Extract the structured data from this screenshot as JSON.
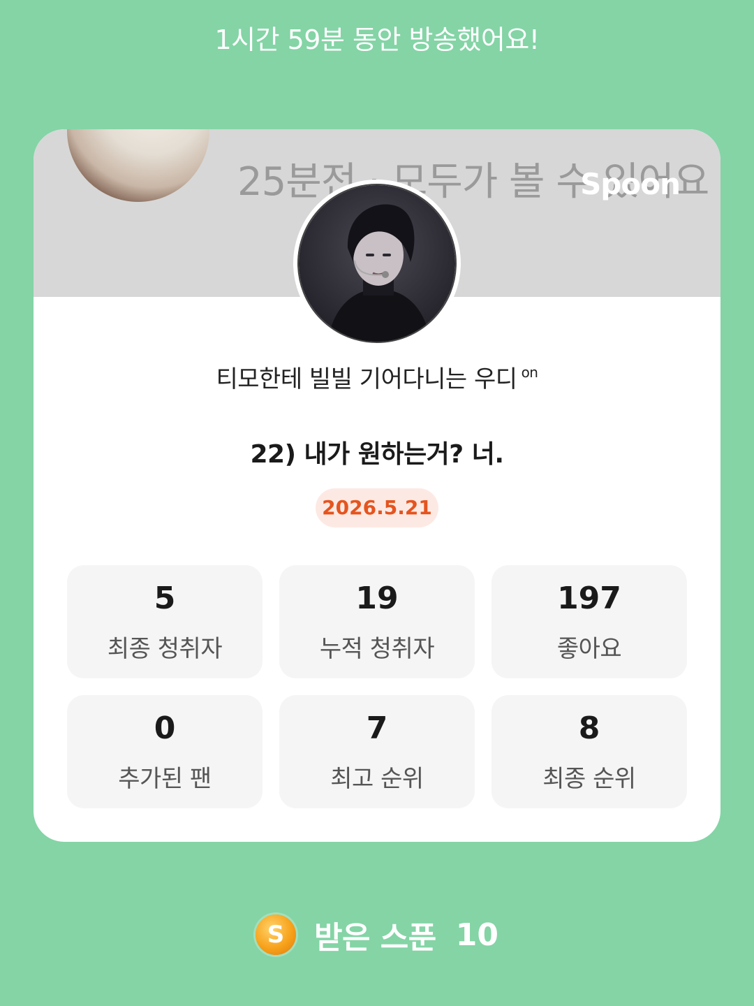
{
  "header": {
    "duration_text": "1시간 59분 동안 방송했어요!"
  },
  "banner": {
    "subtitle": "25분전 · 모두가 볼 수 있어요",
    "brand": "Spoon"
  },
  "dj": {
    "name": "티모한테 빌빌 기어다니는 우디",
    "badge": "on"
  },
  "broadcast": {
    "title": "22) 내가 원하는거? 너.",
    "date": "2026.5.21"
  },
  "stats": [
    {
      "value": "5",
      "label": "최종 청취자"
    },
    {
      "value": "19",
      "label": "누적 청취자"
    },
    {
      "value": "197",
      "label": "좋아요"
    },
    {
      "value": "0",
      "label": "추가된 팬"
    },
    {
      "value": "7",
      "label": "최고 순위"
    },
    {
      "value": "8",
      "label": "최종 순위"
    }
  ],
  "footer": {
    "coin_letter": "S",
    "label": "받은 스푼",
    "count": "10"
  },
  "colors": {
    "background": "#84d4a6",
    "date_accent": "#e5541f",
    "coin": "#f7a21b"
  }
}
